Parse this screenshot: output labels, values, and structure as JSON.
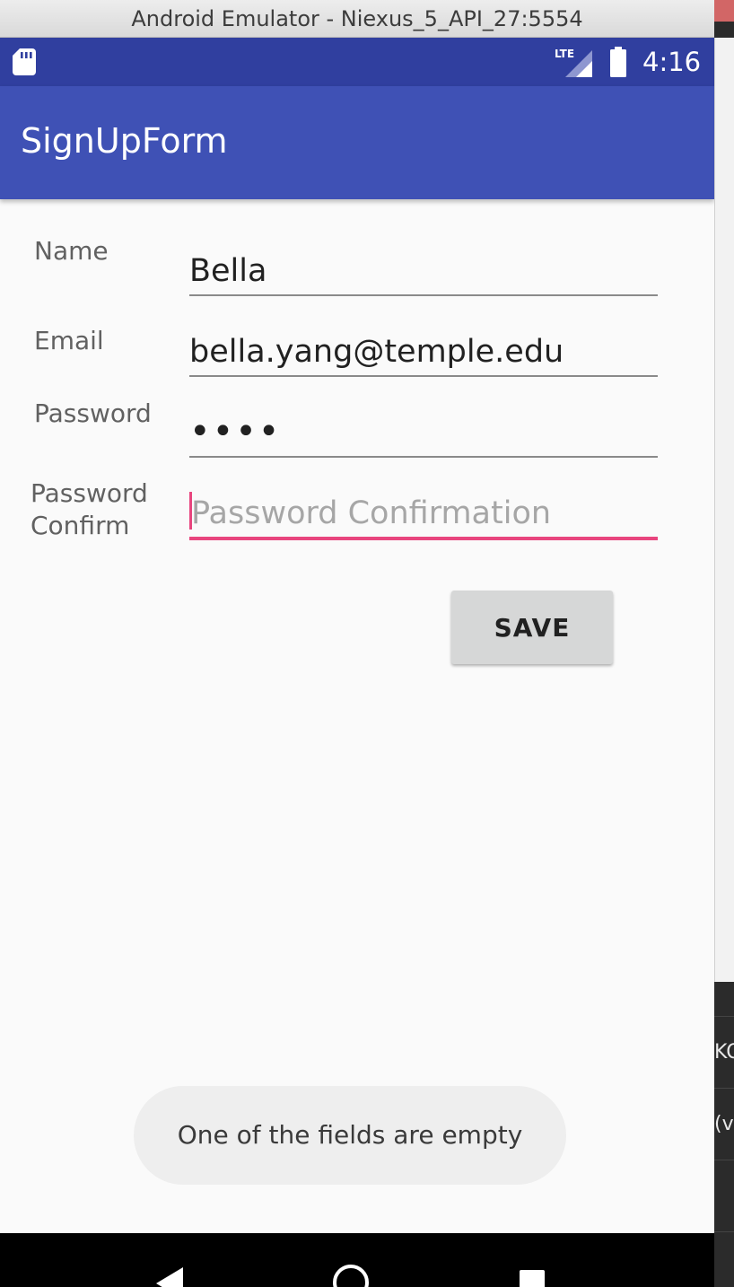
{
  "window": {
    "title": "Android Emulator - Niexus_5_API_27:5554"
  },
  "status_bar": {
    "time": "4:16",
    "network": "LTE",
    "icons": [
      "sd-card-icon",
      "lte-signal-icon",
      "battery-icon"
    ]
  },
  "app_bar": {
    "title": "SignUpForm"
  },
  "form": {
    "name": {
      "label": "Name",
      "value": "Bella"
    },
    "email": {
      "label": "Email",
      "value": "bella.yang@temple.edu"
    },
    "password": {
      "label": "Password",
      "value": "••••"
    },
    "password_confirm": {
      "label_line1": "Password",
      "label_line2": "Confirm",
      "value": "",
      "placeholder": "Password Confirmation"
    },
    "save_label": "SAVE"
  },
  "toast": {
    "message": "One of the fields are empty"
  },
  "side_window": {
    "row1": "KO",
    "row2": "(v"
  },
  "colors": {
    "status_bar": "#303f9f",
    "app_bar": "#3f51b5",
    "accent": "#e8457e",
    "button": "#d6d7d7",
    "background": "#fafafa"
  }
}
